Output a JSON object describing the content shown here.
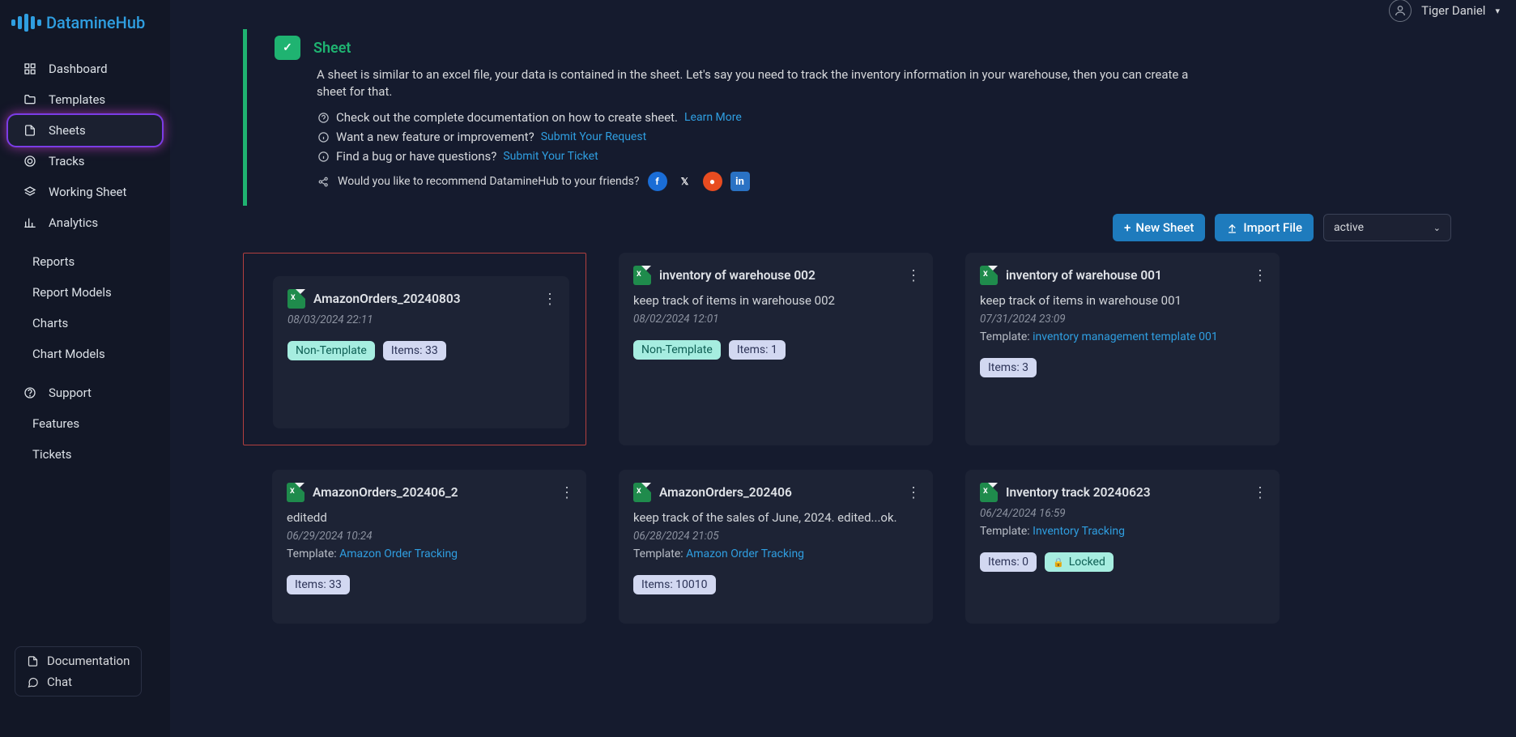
{
  "user": {
    "name": "Tiger Daniel"
  },
  "brand": "DatamineHub",
  "nav": {
    "dashboard": "Dashboard",
    "templates": "Templates",
    "sheets": "Sheets",
    "tracks": "Tracks",
    "working": "Working Sheet",
    "analytics": "Analytics",
    "reports": "Reports",
    "reportModels": "Report Models",
    "charts": "Charts",
    "chartModels": "Chart Models",
    "support": "Support",
    "features": "Features",
    "tickets": "Tickets",
    "documentation": "Documentation",
    "chat": "Chat"
  },
  "banner": {
    "title": "Sheet",
    "desc": "A sheet is similar to an excel file, your data is contained in the sheet. Let's say you need to track the inventory information in your warehouse, then you can create a sheet for that.",
    "row1": "Check out the complete documentation on how to create sheet.",
    "learnMore": "Learn More",
    "row2": "Want a new feature or improvement?",
    "submitRequest": "Submit Your Request",
    "row3": "Find a bug or have questions?",
    "submitTicket": "Submit Your Ticket",
    "share": "Would you like to recommend DatamineHub to your friends?"
  },
  "toolbar": {
    "newSheet": "New Sheet",
    "importFile": "Import File",
    "filter": "active"
  },
  "labels": {
    "templatePrefix": "Template:",
    "nonTemplate": "Non-Template",
    "locked": "Locked"
  },
  "cards": [
    {
      "title": "AmazonOrders_20240803",
      "desc": "",
      "date": "08/03/2024 22:11",
      "template": null,
      "nonTemplate": true,
      "items": "Items: 33",
      "locked": false
    },
    {
      "title": "inventory of warehouse 002",
      "desc": "keep track of items in warehouse 002",
      "date": "08/02/2024 12:01",
      "template": null,
      "nonTemplate": true,
      "items": "Items: 1",
      "locked": false
    },
    {
      "title": "inventory of warehouse 001",
      "desc": "keep track of items in warehouse 001",
      "date": "07/31/2024 23:09",
      "template": "inventory management template 001",
      "nonTemplate": false,
      "items": "Items: 3",
      "locked": false
    },
    {
      "title": "AmazonOrders_202406_2",
      "desc": "editedd",
      "date": "06/29/2024 10:24",
      "template": "Amazon Order Tracking",
      "nonTemplate": false,
      "items": "Items: 33",
      "locked": false
    },
    {
      "title": "AmazonOrders_202406",
      "desc": "keep track of the sales of June, 2024. edited...ok.",
      "date": "06/28/2024 21:05",
      "template": "Amazon Order Tracking",
      "nonTemplate": false,
      "items": "Items: 10010",
      "locked": false
    },
    {
      "title": "Inventory track 20240623",
      "desc": "",
      "date": "06/24/2024 16:59",
      "template": "Inventory Tracking",
      "nonTemplate": false,
      "items": "Items: 0",
      "locked": true
    }
  ]
}
